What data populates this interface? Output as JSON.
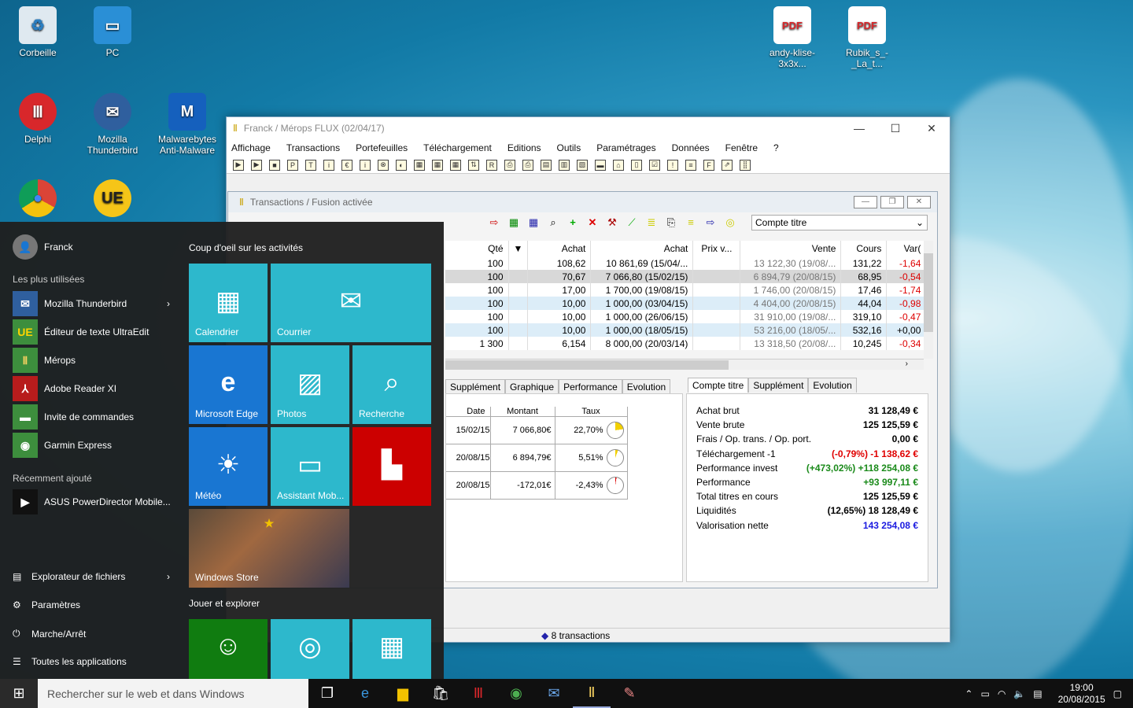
{
  "desktop": {
    "icons": [
      {
        "label": "Corbeille",
        "icon": "recycle-bin-icon"
      },
      {
        "label": "PC",
        "icon": "computer-icon"
      },
      {
        "label": "Delphi",
        "icon": "delphi-icon"
      },
      {
        "label": "Mozilla Thunderbird",
        "icon": "thunderbird-icon"
      },
      {
        "label": "Malwarebytes Anti-Malware",
        "icon": "malwarebytes-icon"
      },
      {
        "label": "Google Chrome",
        "icon": "chrome-icon"
      },
      {
        "label": "UltraEdit",
        "icon": "ultraedit-icon"
      },
      {
        "label": "andy-klise-3x3x...",
        "icon": "pdf-icon"
      },
      {
        "label": "Rubik_s_-_La_t...",
        "icon": "pdf-icon"
      }
    ]
  },
  "app": {
    "title": "Franck / Mérops FLUX (02/04/17)",
    "menu": [
      "Affichage",
      "Transactions",
      "Portefeuilles",
      "Téléchargement",
      "Editions",
      "Outils",
      "Paramétrages",
      "Données",
      "Fenêtre",
      "?"
    ],
    "toolbar_glyphs": [
      "▶",
      "▶",
      "■",
      "P",
      "T",
      "i",
      "€",
      "i",
      "⊗",
      "◐",
      "▦",
      "▦",
      "▦",
      "⇅",
      "R",
      "⎙",
      "⎙",
      "▤",
      "▥",
      "▧",
      "▬",
      "⌂",
      "▯",
      "☑",
      "!",
      "≡",
      "F",
      "⇗",
      "⣿"
    ],
    "sub": {
      "title": "Transactions / Fusion activée",
      "account_select": "Compte titre",
      "columns": [
        "Qté",
        "",
        "Achat",
        "Achat",
        "Prix v...",
        "Vente",
        "Cours",
        "Var("
      ],
      "rows": [
        [
          "100",
          "",
          "108,62",
          "10 861,69 (15/04/...",
          "",
          "13 122,30 (19/08/...",
          "131,22",
          "-1,64"
        ],
        [
          "100",
          "",
          "70,67",
          "7 066,80 (15/02/15)",
          "",
          "6 894,79 (20/08/15)",
          "68,95",
          "-0,54"
        ],
        [
          "100",
          "",
          "17,00",
          "1 700,00 (19/08/15)",
          "",
          "1 746,00 (20/08/15)",
          "17,46",
          "-1,74"
        ],
        [
          "100",
          "",
          "10,00",
          "1 000,00 (03/04/15)",
          "",
          "4 404,00 (20/08/15)",
          "44,04",
          "-0,98"
        ],
        [
          "100",
          "",
          "10,00",
          "1 000,00 (26/06/15)",
          "",
          "31 910,00 (19/08/...",
          "319,10",
          "-0,47"
        ],
        [
          "100",
          "",
          "10,00",
          "1 000,00 (18/05/15)",
          "",
          "53 216,00 (18/05/...",
          "532,16",
          "+0,00"
        ],
        [
          "1 300",
          "",
          "6,154",
          "8 000,00 (20/03/14)",
          "",
          "13 318,50 (20/08/...",
          "10,245",
          "-0,34"
        ]
      ],
      "left_tabs": [
        "Supplément",
        "Graphique",
        "Performance",
        "Evolution"
      ],
      "right_tabs": [
        "Compte titre",
        "Supplément",
        "Evolution"
      ],
      "mini_headers": [
        "Date",
        "Montant",
        "Taux"
      ],
      "mini_rows": [
        [
          "15/02/15",
          "7 066,80€",
          "22,70%"
        ],
        [
          "20/08/15",
          "6 894,79€",
          "5,51%"
        ],
        [
          "20/08/15",
          "-172,01€",
          "-2,43%"
        ]
      ],
      "summary": [
        {
          "label": "Achat brut",
          "value": "31 128,49 €",
          "color": "#000"
        },
        {
          "label": "Vente brute",
          "value": "125 125,59 €",
          "color": "#000"
        },
        {
          "label": "Frais / Op. trans. / Op. port.",
          "value": "0,00 €",
          "color": "#000"
        },
        {
          "label": "Téléchargement -1",
          "value": "(-0,79%) -1 138,62 €",
          "color": "#e00000"
        },
        {
          "label": "Performance invest",
          "value": "(+473,02%) +118 254,08 €",
          "color": "#1a8a1a"
        },
        {
          "label": "Performance",
          "value": "+93 997,11 €",
          "color": "#1a8a1a"
        },
        {
          "label": "Total titres en cours",
          "value": "125 125,59 €",
          "color": "#000"
        },
        {
          "label": "Liquidités",
          "value": "(12,65%) 18 128,49 €",
          "color": "#000"
        },
        {
          "label": "Valorisation nette",
          "value": "143 254,08 €",
          "color": "#1a1ae0"
        }
      ],
      "status": "8 transactions"
    }
  },
  "start": {
    "user": "Franck",
    "most_used_label": "Les plus utilisées",
    "most_used": [
      "Mozilla Thunderbird",
      "Éditeur de texte UltraEdit",
      "Mérops",
      "Adobe Reader XI",
      "Invite de commandes",
      "Garmin Express"
    ],
    "recent_label": "Récemment ajouté",
    "recent": [
      "ASUS PowerDirector Mobile..."
    ],
    "bottom": [
      "Explorateur de fichiers",
      "Paramètres",
      "Marche/Arrêt",
      "Toutes les applications"
    ],
    "section1": "Coup d'oeil sur les activités",
    "section2": "Jouer et explorer",
    "tiles": [
      "Calendrier",
      "Courrier",
      "Microsoft Edge",
      "Photos",
      "Recherche",
      "Météo",
      "Assistant Mob...",
      "Windows Store"
    ]
  },
  "taskbar": {
    "search_placeholder": "Rechercher sur le web et dans Windows",
    "time": "19:00",
    "date": "20/08/2015"
  }
}
